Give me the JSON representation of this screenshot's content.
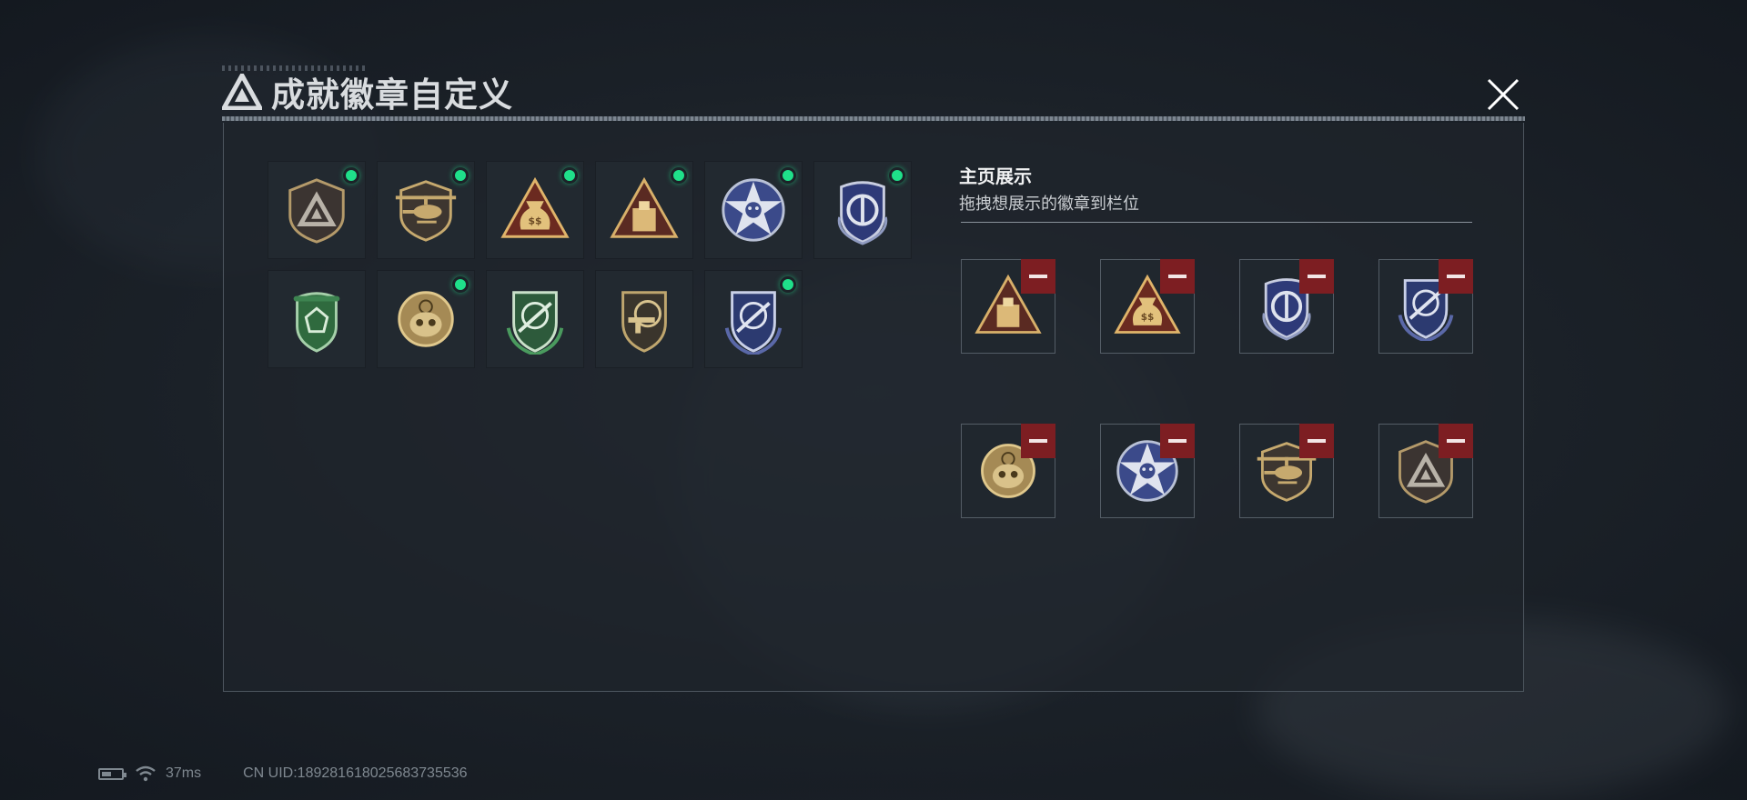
{
  "dialog": {
    "title": "成就徽章自定义"
  },
  "colors": {
    "owned_dot": "#1fe08a",
    "remove": "#7d1e22",
    "panel_border": "#4d565f"
  },
  "collection": {
    "badges": [
      {
        "icon": "tri-logo-shield-icon",
        "in_showcase": true
      },
      {
        "icon": "helicopter-shield-icon",
        "in_showcase": true
      },
      {
        "icon": "money-bag-triangle-icon",
        "in_showcase": true
      },
      {
        "icon": "crate-triangle-icon",
        "in_showcase": true
      },
      {
        "icon": "blue-star-skull-icon",
        "in_showcase": true
      },
      {
        "icon": "blue-wreath-shield-icon",
        "in_showcase": true
      },
      {
        "icon": "green-gem-shield-icon",
        "in_showcase": false
      },
      {
        "icon": "gold-skull-crosshair-icon",
        "in_showcase": true
      },
      {
        "icon": "green-rifle-shield-icon",
        "in_showcase": false
      },
      {
        "icon": "gold-smg-shield-icon",
        "in_showcase": false
      },
      {
        "icon": "blue-rifle-shield-icon",
        "in_showcase": true
      }
    ]
  },
  "showcase": {
    "title": "主页展示",
    "subtitle": "拖拽想展示的徽章到栏位",
    "slots": [
      {
        "icon": "crate-triangle-icon"
      },
      {
        "icon": "money-bag-triangle-icon"
      },
      {
        "icon": "blue-wreath-shield-icon"
      },
      {
        "icon": "blue-rifle-shield-icon"
      },
      {
        "icon": "gold-skull-crosshair-icon"
      },
      {
        "icon": "blue-star-skull-icon"
      },
      {
        "icon": "helicopter-shield-icon"
      },
      {
        "icon": "tri-logo-shield-icon"
      }
    ]
  },
  "status_bar": {
    "ping": "37ms",
    "uid": "CN UID:1892816180256837355​36"
  }
}
